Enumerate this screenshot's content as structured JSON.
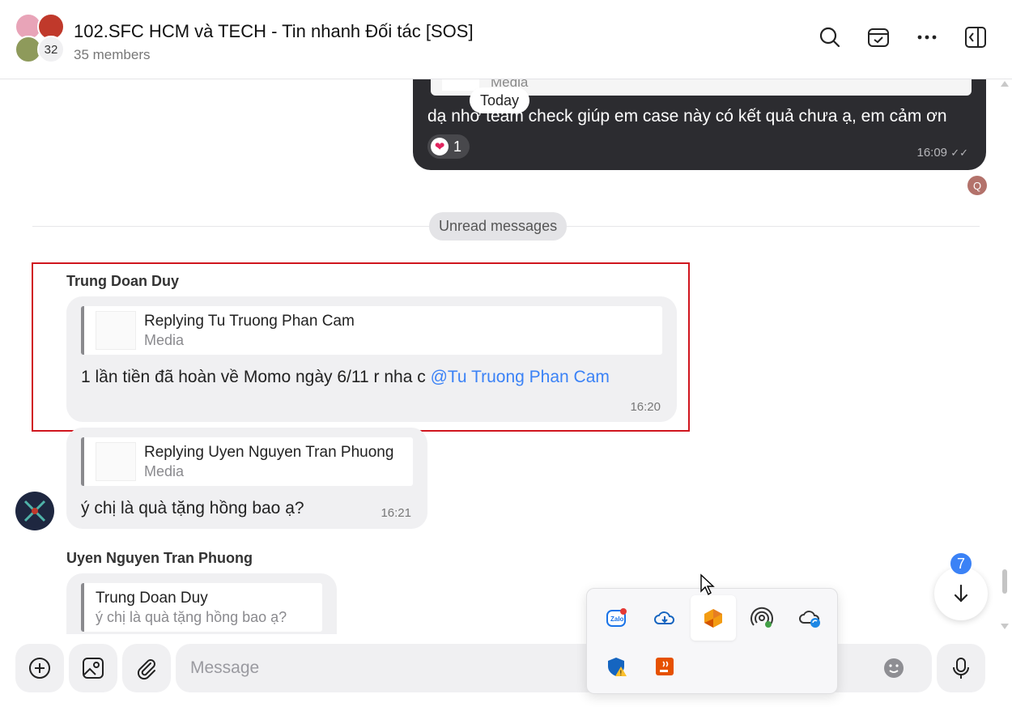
{
  "header": {
    "title": "102.SFC HCM và TECH - Tin nhanh Đối tác [SOS]",
    "members": "35 members",
    "avatar_count": "32"
  },
  "messages": {
    "mine": {
      "reply_label": "Media",
      "text": "dạ nhờ team check giúp em case này có kết quả chưa ạ, em cảm ơn",
      "reaction_count": "1",
      "time": "16:09"
    },
    "today_label": "Today",
    "seen_initial": "Q",
    "unread_label": "Unread messages",
    "trung": {
      "sender": "Trung Doan Duy",
      "reply_title": "Replying Tu Truong Phan Cam",
      "reply_sub": "Media",
      "text": "1 lần tiền đã hoàn về Momo ngày 6/11 r nha c ",
      "mention": "@Tu Truong Phan Cam",
      "time": "16:20"
    },
    "trung2": {
      "reply_title": "Replying Uyen Nguyen Tran Phuong",
      "reply_sub": "Media",
      "text": "ý chị là quà tặng hồng bao ạ?",
      "time": "16:21"
    },
    "uyen": {
      "sender": "Uyen Nguyen Tran Phuong",
      "reply_title": "Trung Doan Duy",
      "reply_sub": "ý chị là quà tặng hồng bao ạ?"
    }
  },
  "scroll_down": {
    "unread_count": "7"
  },
  "composer": {
    "placeholder": "Message"
  },
  "tray": {
    "icons": [
      "zalo-icon",
      "onedrive-icon",
      "app-icon",
      "hotspot-icon",
      "cloud-sync-icon",
      "defender-warning-icon",
      "java-icon"
    ]
  },
  "colors": {
    "accent": "#3b82f6",
    "highlight": "#d0161e",
    "my_bubble": "#2c2c30"
  }
}
